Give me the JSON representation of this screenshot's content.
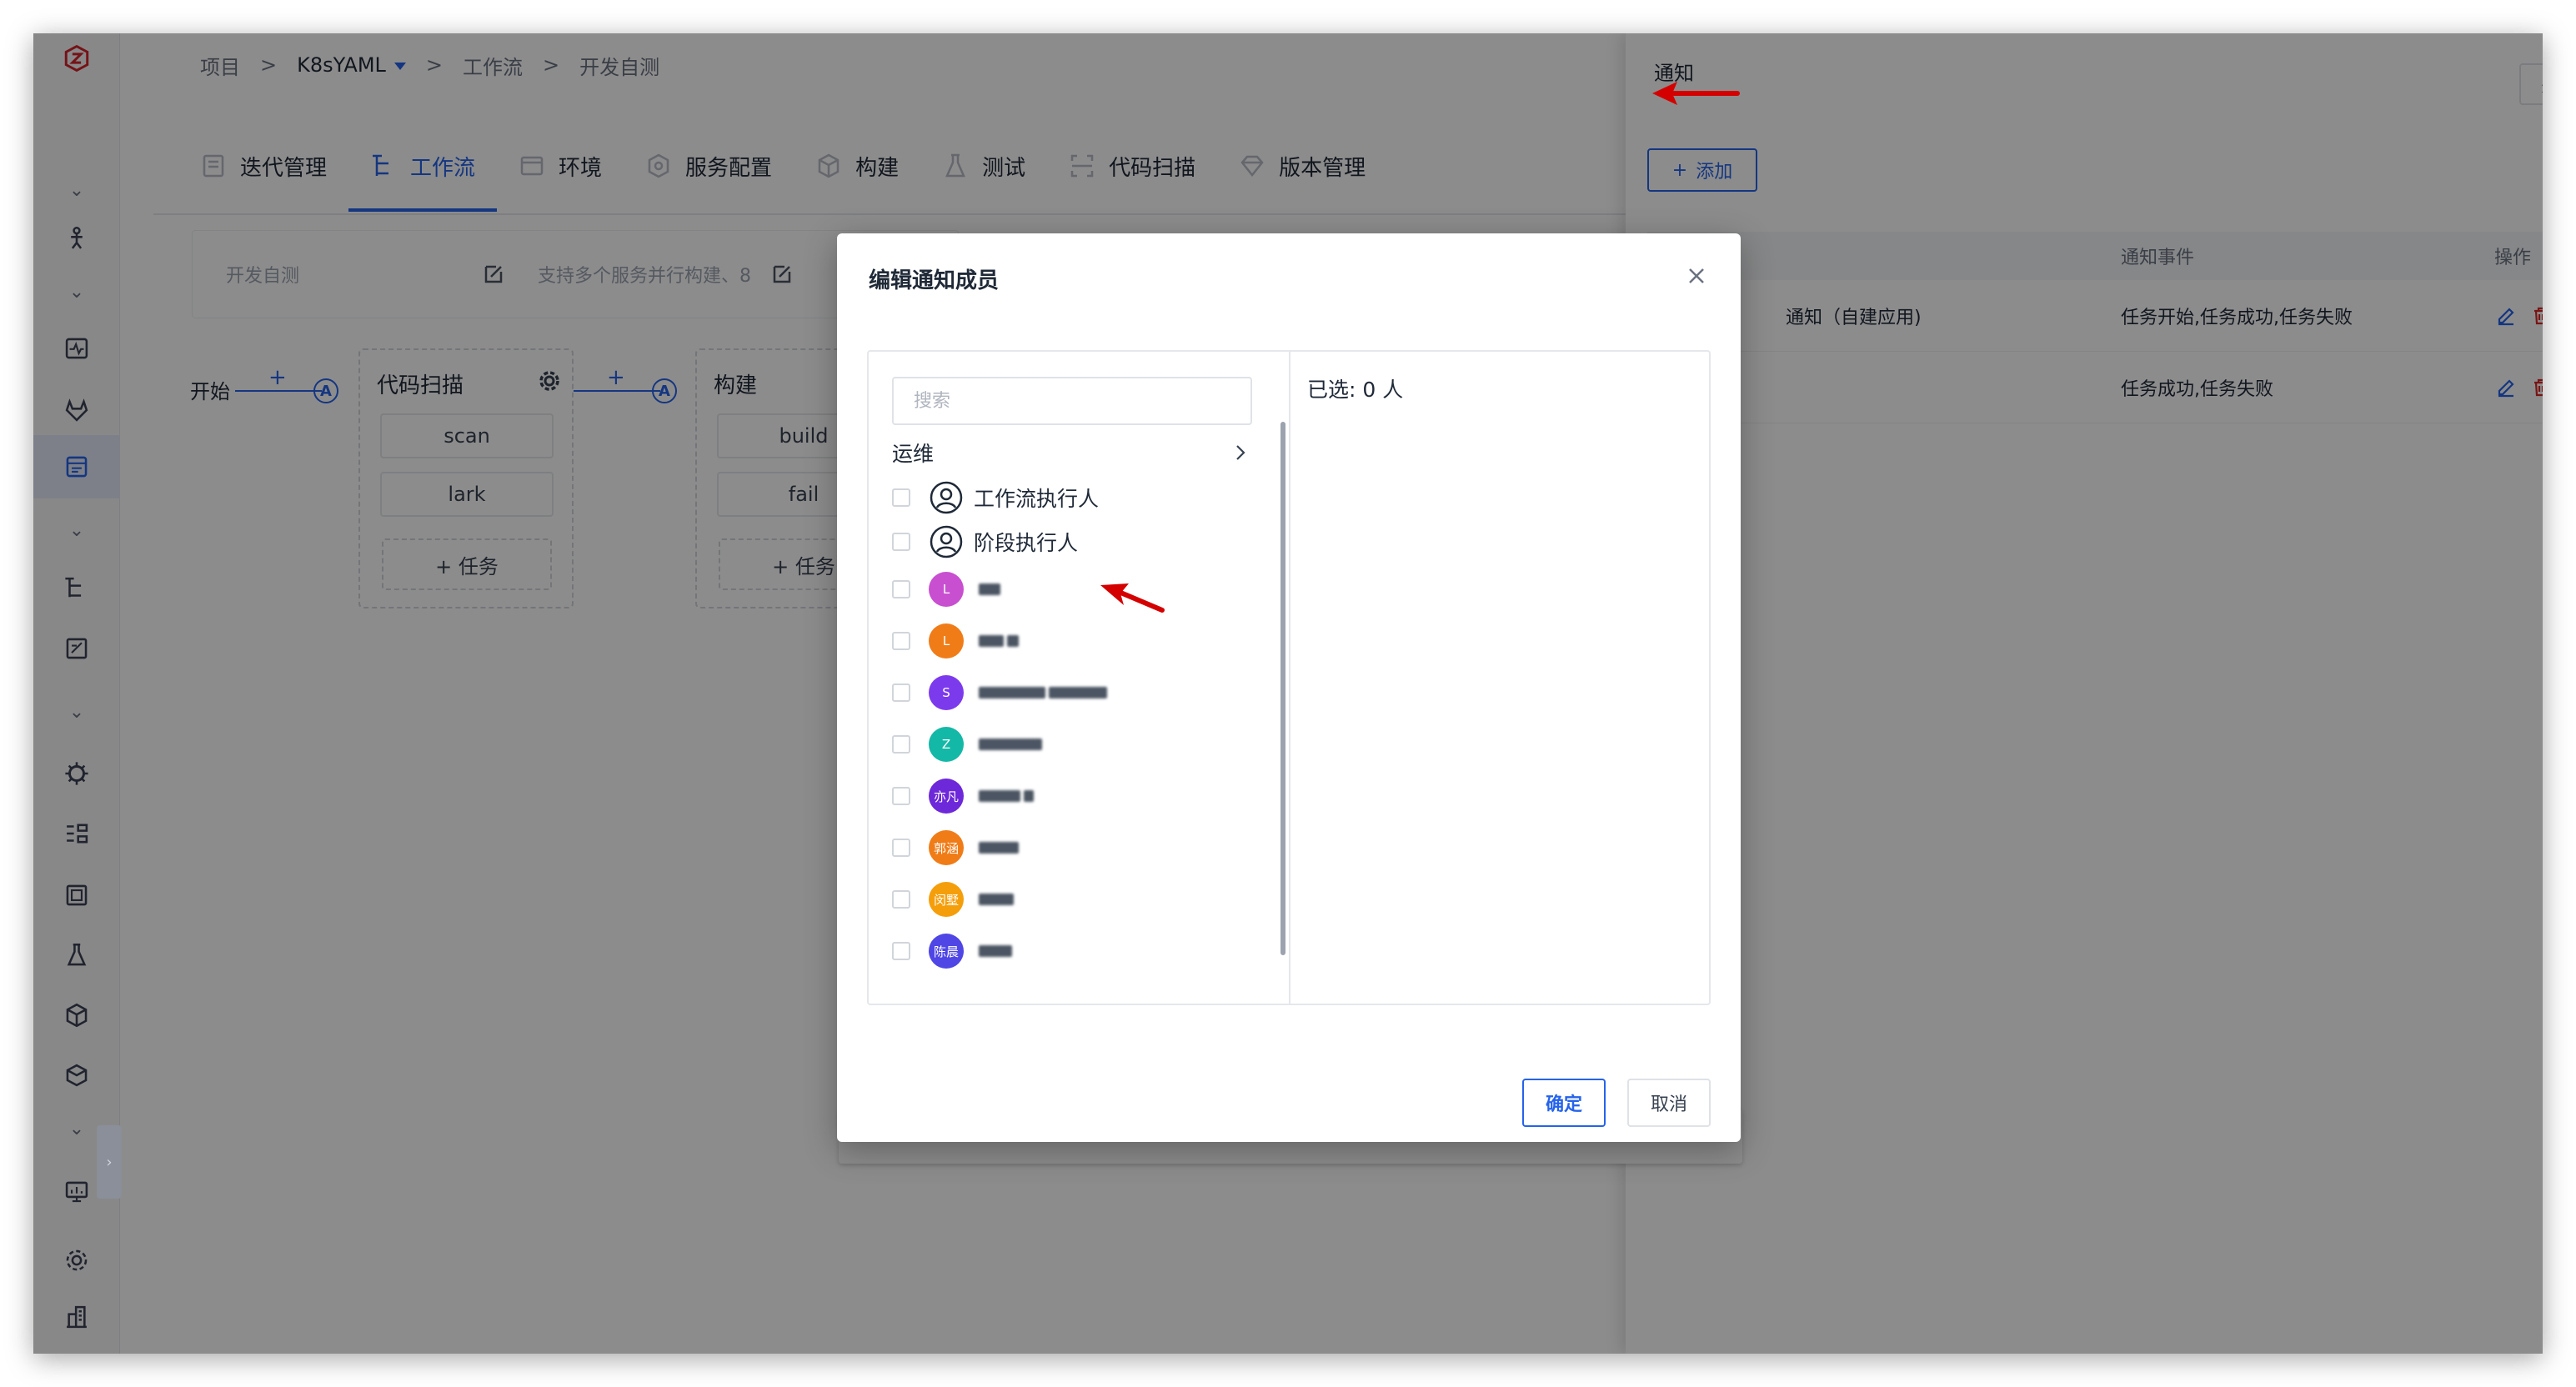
{
  "breadcrumb": {
    "items": [
      "项目",
      ">",
      "K8sYAML",
      ">",
      "工作流",
      ">",
      "开发自测"
    ],
    "separator": ">"
  },
  "tabs": [
    {
      "label": "迭代管理",
      "icon": "iteration-icon"
    },
    {
      "label": "工作流",
      "icon": "workflow-icon",
      "active": true
    },
    {
      "label": "环境",
      "icon": "environment-icon"
    },
    {
      "label": "服务配置",
      "icon": "service-config-icon"
    },
    {
      "label": "构建",
      "icon": "build-icon"
    },
    {
      "label": "测试",
      "icon": "test-flask-icon"
    },
    {
      "label": "代码扫描",
      "icon": "code-scan-icon"
    },
    {
      "label": "版本管理",
      "icon": "version-icon"
    }
  ],
  "workflow": {
    "name": "开发自测",
    "description": "支持多个服务并行构建、8",
    "start_label": "开始",
    "plus": "+",
    "badge": "A",
    "stages": [
      {
        "name": "代码扫描",
        "jobs": [
          "scan",
          "lark"
        ],
        "add_task": "+ 任务"
      },
      {
        "name": "构建",
        "jobs": [
          "build",
          "fail"
        ],
        "add_task": "+ 任务"
      }
    ]
  },
  "drawer": {
    "title": "通知",
    "close_label": "关闭",
    "add_label": "添加",
    "add_icon": "+",
    "table": {
      "headers": [
        "通知事件",
        "操作"
      ],
      "rows": [
        {
          "type": "通知（自建应用)",
          "events": "任务开始,任务成功,任务失败"
        },
        {
          "type": "",
          "events": "任务成功,任务失败"
        }
      ]
    }
  },
  "modal": {
    "title": "编辑通知成员",
    "search_placeholder": "搜索",
    "group_label": "运维",
    "selected_label": "已选: 0 人",
    "confirm_label": "确定",
    "cancel_label": "取消",
    "members": [
      {
        "name": "工作流执行人",
        "type": "role"
      },
      {
        "name": "阶段执行人",
        "type": "role"
      },
      {
        "avatar": "L",
        "color": "#c84fd0",
        "type": "user"
      },
      {
        "avatar": "L",
        "color": "#f07c18",
        "type": "user"
      },
      {
        "avatar": "S",
        "color": "#7c3aed",
        "type": "user"
      },
      {
        "avatar": "Z",
        "color": "#14b8a6",
        "type": "user"
      },
      {
        "avatar": "亦凡",
        "color": "#6d28d9",
        "type": "user"
      },
      {
        "avatar": "郭涵",
        "color": "#f07c18",
        "type": "user"
      },
      {
        "avatar": "闵墅",
        "color": "#f59e0b",
        "type": "user"
      },
      {
        "avatar": "陈晨",
        "color": "#4f46e5",
        "type": "user"
      }
    ]
  },
  "colors": {
    "accent": "#2563eb",
    "danger": "#dc2626",
    "annotation_arrow": "#d40000"
  }
}
